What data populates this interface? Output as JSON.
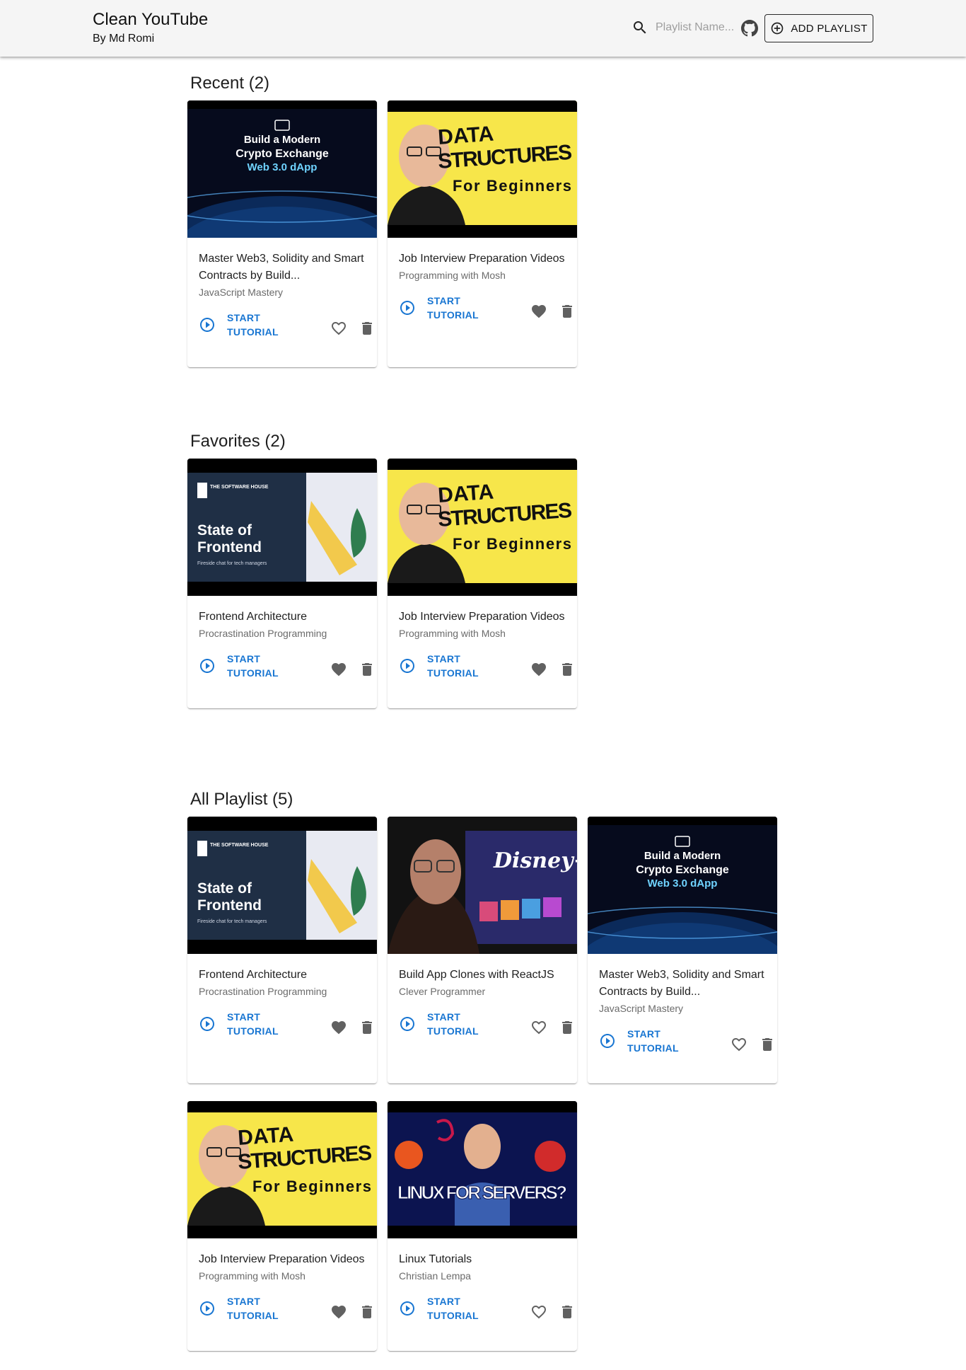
{
  "header": {
    "title": "Clean YouTube",
    "subtitle": "By Md Romi",
    "search_placeholder": "Playlist Name...",
    "add_playlist_label": "ADD PLAYLIST",
    "icons": {
      "search": "search-icon",
      "github": "github-icon",
      "add": "add-circle-icon"
    }
  },
  "colors": {
    "accent": "#1976d2",
    "appbar_bg": "#f5f5f5",
    "favorite_filled": "#616161"
  },
  "card_action_label": "START TUTORIAL",
  "sections": [
    {
      "title": "Recent (2)",
      "cards": [
        {
          "title": "Master Web3, Solidity and Smart Contracts by Build...",
          "channel": "JavaScript Mastery",
          "favorite": false,
          "thumb_text": [
            "Build a Modern",
            "Crypto Exchange",
            "Web 3.0 dApp"
          ]
        },
        {
          "title": "Job Interview Preparation Videos",
          "channel": "Programming with Mosh",
          "favorite": true,
          "thumb_text": [
            "DATA",
            "STRUCTURES",
            "For Beginners"
          ]
        }
      ]
    },
    {
      "title": "Favorites (2)",
      "cards": [
        {
          "title": "Frontend Architecture",
          "channel": "Procrastination Programming",
          "favorite": true,
          "thumb_text": [
            "THE SOFTWARE HOUSE",
            "State of",
            "Frontend",
            "Fireside chat for tech managers"
          ]
        },
        {
          "title": "Job Interview Preparation Videos",
          "channel": "Programming with Mosh",
          "favorite": true,
          "thumb_text": [
            "DATA",
            "STRUCTURES",
            "For Beginners"
          ]
        }
      ]
    },
    {
      "title": "All Playlist (5)",
      "cards": [
        {
          "title": "Frontend Architecture",
          "channel": "Procrastination Programming",
          "favorite": true,
          "thumb_text": [
            "THE SOFTWARE HOUSE",
            "State of",
            "Frontend",
            "Fireside chat for tech managers"
          ]
        },
        {
          "title": "Build App Clones with ReactJS",
          "channel": "Clever Programmer",
          "favorite": false,
          "thumb_text": [
            "Disney+"
          ]
        },
        {
          "title": "Master Web3, Solidity and Smart Contracts by Build...",
          "channel": "JavaScript Mastery",
          "favorite": false,
          "thumb_text": [
            "Build a Modern",
            "Crypto Exchange",
            "Web 3.0 dApp"
          ]
        },
        {
          "title": "Job Interview Preparation Videos",
          "channel": "Programming with Mosh",
          "favorite": true,
          "thumb_text": [
            "DATA",
            "STRUCTURES",
            "For Beginners"
          ]
        },
        {
          "title": "Linux Tutorials",
          "channel": "Christian Lempa",
          "favorite": false,
          "thumb_text": [
            "LINUX FOR SERVERS?"
          ]
        }
      ]
    }
  ]
}
